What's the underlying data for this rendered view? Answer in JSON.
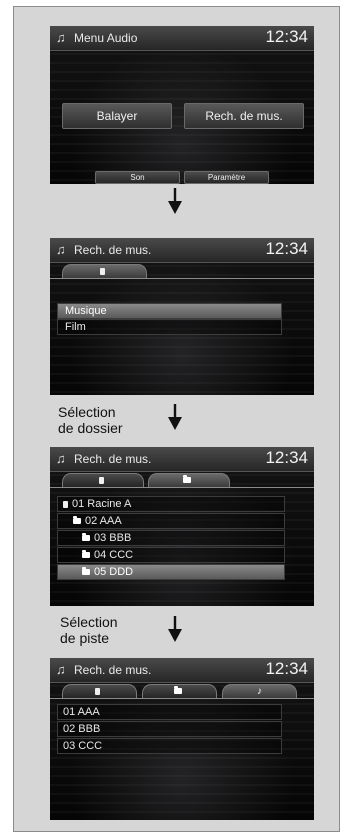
{
  "screen1": {
    "icon": "music-note-icon",
    "title": "Menu Audio",
    "clock": "12:34",
    "buttons": [
      "Balayer",
      "Rech. de mus."
    ],
    "small_buttons": [
      "Son",
      "Paramètre"
    ]
  },
  "screen2": {
    "icon": "music-note-icon",
    "title": "Rech. de mus.",
    "clock": "12:34",
    "tab_icon": "usb-device-icon",
    "items": [
      "Musique",
      "Film"
    ],
    "selected_index": 0
  },
  "step3_caption": [
    "Sélection",
    "de dossier"
  ],
  "screen3": {
    "icon": "music-note-icon",
    "title": "Rech. de mus.",
    "clock": "12:34",
    "tab_icons": [
      "usb-device-icon",
      "folder-icon"
    ],
    "folders": [
      "01 Racine A",
      "02 AAA",
      "03 BBB",
      "04 CCC",
      "05 DDD"
    ],
    "selected_index": 4
  },
  "step4_caption": [
    "Sélection",
    "de piste"
  ],
  "screen4": {
    "icon": "music-note-icon",
    "title": "Rech. de mus.",
    "clock": "12:34",
    "tab_icons": [
      "usb-device-icon",
      "folder-icon",
      "music-note-icon"
    ],
    "tracks": [
      "01 AAA",
      "02 BBB",
      "03 CCC"
    ]
  }
}
